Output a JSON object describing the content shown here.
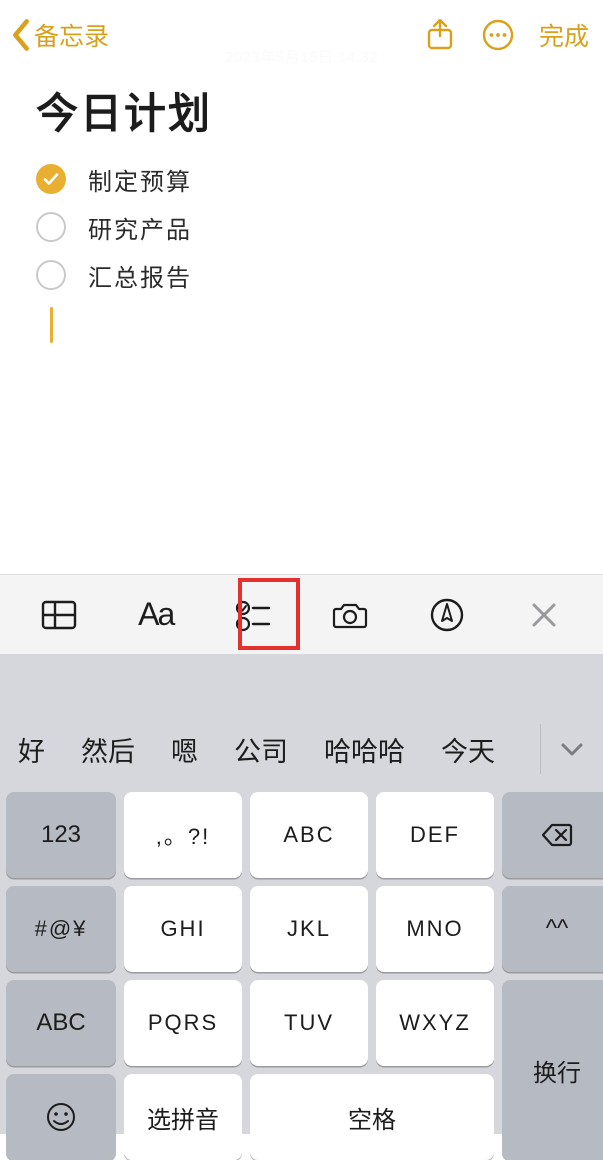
{
  "nav": {
    "back_label": "备忘录",
    "done_label": "完成",
    "faded_timestamp": "2023年5月15日 14:32"
  },
  "note": {
    "title": "今日计划",
    "items": [
      {
        "checked": true,
        "text": "制定预算"
      },
      {
        "checked": false,
        "text": "研究产品"
      },
      {
        "checked": false,
        "text": "汇总报告"
      }
    ]
  },
  "toolbar": {
    "text_format_label": "Aa"
  },
  "candidates": [
    "好",
    "然后",
    "嗯",
    "公司",
    "哈哈哈",
    "今天"
  ],
  "keypad": {
    "row1": [
      "123",
      ",。?!",
      "ABC",
      "DEF"
    ],
    "row2": [
      "#@¥",
      "GHI",
      "JKL",
      "MNO",
      "^^"
    ],
    "row3": [
      "ABC",
      "PQRS",
      "TUV",
      "WXYZ"
    ],
    "row4_pinyin": "选拼音",
    "row4_space": "空格",
    "enter_label": "换行"
  },
  "colors": {
    "accent": "#e9af30",
    "nav_tint": "#d9a11b",
    "highlight_border": "#e53030"
  }
}
